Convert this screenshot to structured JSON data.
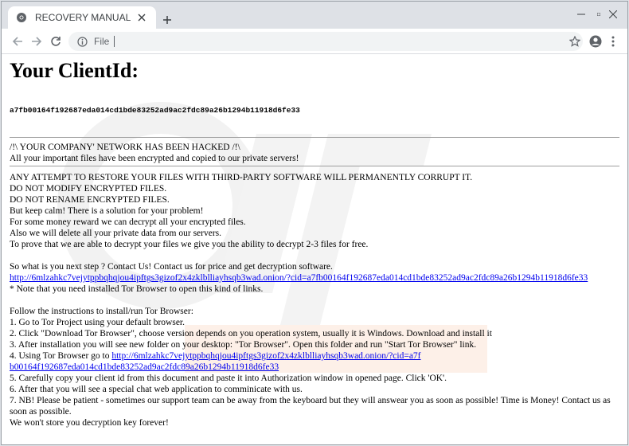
{
  "browser": {
    "tab_title": "RECOVERY MANUAL",
    "address_scheme": "File"
  },
  "page": {
    "heading": "Your ClientId:",
    "client_id": "a7fb00164f192687eda014cd1bde83252ad9ac2fdc89a26b1294b11918d6fe33",
    "hacked_line": "/!\\ YOUR COMPANY' NETWORK HAS BEEN HACKED /!\\",
    "encrypted_line": "All your important files have been encrypted and copied to our private servers!",
    "warning_lines": [
      "ANY ATTEMPT TO RESTORE YOUR FILES WITH THIRD-PARTY SOFTWARE WILL PERMANENTLY CORRUPT IT.",
      "DO NOT MODIFY ENCRYPTED FILES.",
      "DO NOT RENAME ENCRYPTED FILES.",
      "But keep calm! There is a solution for your problem!",
      "For some money reward we can decrypt all your encrypted files.",
      "Also we will delete all your private data from our servers.",
      "To prove that we are able to decrypt your files we give you the ability to decrypt 2-3 files for free."
    ],
    "next_step": "So what is you next step ? Contact Us! Contact us for price and get decryption software.",
    "onion_link": "http://6mlzahkc7vejytppbqhqjou4ipftgs3gizof2x4zklblliayhsqb3wad.onion/?cid=a7fb00164f192687eda014cd1bde83252ad9ac2fdc89a26b1294b11918d6fe33",
    "tor_note": "* Note that you need installed Tor Browser to open this kind of links.",
    "instructions_title": "Follow the instructions to install/run Tor Browser:",
    "step1": "1. Go to Tor Project using your default browser.",
    "step2": "2. Click \"Download Tor Browser\", choose version depends on you operation system, usually it is Windows. Download and install it",
    "step3": "3. After installation you will see new folder on your desktop: \"Tor Browser\". Open this folder and run \"Start Tor Browser\" link.",
    "step4_prefix": "4. Using Tor Browser go to ",
    "step4_link": "http://6mlzahkc7vejytppbqhqjou4ipftgs3gizof2x4zklblliayhsqb3wad.onion/?cid=a7fb00164f192687eda014cd1bde83252ad9ac2fdc89a26b1294b11918d6fe33",
    "step5": "5. Carefully copy your client id from this document and paste it into Authorization window in opened page. Click 'OK'.",
    "step6": "6. After that you will see a special chat web application to comminicate with us.",
    "step7": "7. NB! Please be patient - sometimes our support team can be away from the keyboard but they will answear you as soon as possible! Time is Money! Contact us as soon as possible.",
    "closing": "We won't store you decryption key forever!"
  },
  "icons": {
    "favicon": "chrome-icon",
    "tab_close": "close-icon",
    "new_tab": "plus-icon",
    "back": "arrow-left-icon",
    "forward": "arrow-right-icon",
    "reload": "reload-icon",
    "info": "info-icon",
    "bookmark": "star-icon",
    "account": "account-icon",
    "menu": "kebab-menu-icon",
    "minimize": "minimize-icon",
    "maximize": "maximize-icon",
    "close": "window-close-icon"
  },
  "colors": {
    "link": "#0000ee",
    "tabstrip": "#dee1e6",
    "omnibox": "#f1f3f4"
  }
}
